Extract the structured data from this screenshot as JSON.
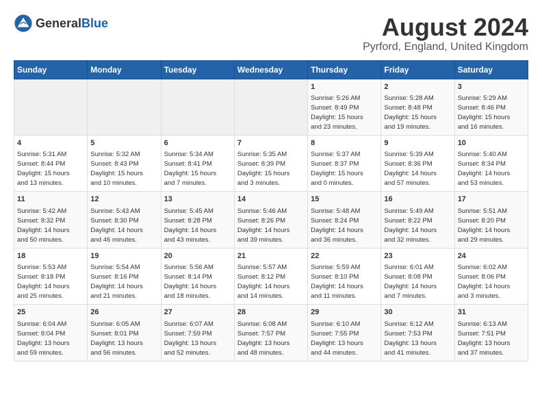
{
  "header": {
    "logo_general": "General",
    "logo_blue": "Blue",
    "title": "August 2024",
    "subtitle": "Pyrford, England, United Kingdom"
  },
  "weekdays": [
    "Sunday",
    "Monday",
    "Tuesday",
    "Wednesday",
    "Thursday",
    "Friday",
    "Saturday"
  ],
  "weeks": [
    [
      {
        "day": "",
        "info": ""
      },
      {
        "day": "",
        "info": ""
      },
      {
        "day": "",
        "info": ""
      },
      {
        "day": "",
        "info": ""
      },
      {
        "day": "1",
        "info": "Sunrise: 5:26 AM\nSunset: 8:49 PM\nDaylight: 15 hours\nand 23 minutes."
      },
      {
        "day": "2",
        "info": "Sunrise: 5:28 AM\nSunset: 8:48 PM\nDaylight: 15 hours\nand 19 minutes."
      },
      {
        "day": "3",
        "info": "Sunrise: 5:29 AM\nSunset: 8:46 PM\nDaylight: 15 hours\nand 16 minutes."
      }
    ],
    [
      {
        "day": "4",
        "info": "Sunrise: 5:31 AM\nSunset: 8:44 PM\nDaylight: 15 hours\nand 13 minutes."
      },
      {
        "day": "5",
        "info": "Sunrise: 5:32 AM\nSunset: 8:43 PM\nDaylight: 15 hours\nand 10 minutes."
      },
      {
        "day": "6",
        "info": "Sunrise: 5:34 AM\nSunset: 8:41 PM\nDaylight: 15 hours\nand 7 minutes."
      },
      {
        "day": "7",
        "info": "Sunrise: 5:35 AM\nSunset: 8:39 PM\nDaylight: 15 hours\nand 3 minutes."
      },
      {
        "day": "8",
        "info": "Sunrise: 5:37 AM\nSunset: 8:37 PM\nDaylight: 15 hours\nand 0 minutes."
      },
      {
        "day": "9",
        "info": "Sunrise: 5:39 AM\nSunset: 8:36 PM\nDaylight: 14 hours\nand 57 minutes."
      },
      {
        "day": "10",
        "info": "Sunrise: 5:40 AM\nSunset: 8:34 PM\nDaylight: 14 hours\nand 53 minutes."
      }
    ],
    [
      {
        "day": "11",
        "info": "Sunrise: 5:42 AM\nSunset: 8:32 PM\nDaylight: 14 hours\nand 50 minutes."
      },
      {
        "day": "12",
        "info": "Sunrise: 5:43 AM\nSunset: 8:30 PM\nDaylight: 14 hours\nand 46 minutes."
      },
      {
        "day": "13",
        "info": "Sunrise: 5:45 AM\nSunset: 8:28 PM\nDaylight: 14 hours\nand 43 minutes."
      },
      {
        "day": "14",
        "info": "Sunrise: 5:46 AM\nSunset: 8:26 PM\nDaylight: 14 hours\nand 39 minutes."
      },
      {
        "day": "15",
        "info": "Sunrise: 5:48 AM\nSunset: 8:24 PM\nDaylight: 14 hours\nand 36 minutes."
      },
      {
        "day": "16",
        "info": "Sunrise: 5:49 AM\nSunset: 8:22 PM\nDaylight: 14 hours\nand 32 minutes."
      },
      {
        "day": "17",
        "info": "Sunrise: 5:51 AM\nSunset: 8:20 PM\nDaylight: 14 hours\nand 29 minutes."
      }
    ],
    [
      {
        "day": "18",
        "info": "Sunrise: 5:53 AM\nSunset: 8:18 PM\nDaylight: 14 hours\nand 25 minutes."
      },
      {
        "day": "19",
        "info": "Sunrise: 5:54 AM\nSunset: 8:16 PM\nDaylight: 14 hours\nand 21 minutes."
      },
      {
        "day": "20",
        "info": "Sunrise: 5:56 AM\nSunset: 8:14 PM\nDaylight: 14 hours\nand 18 minutes."
      },
      {
        "day": "21",
        "info": "Sunrise: 5:57 AM\nSunset: 8:12 PM\nDaylight: 14 hours\nand 14 minutes."
      },
      {
        "day": "22",
        "info": "Sunrise: 5:59 AM\nSunset: 8:10 PM\nDaylight: 14 hours\nand 11 minutes."
      },
      {
        "day": "23",
        "info": "Sunrise: 6:01 AM\nSunset: 8:08 PM\nDaylight: 14 hours\nand 7 minutes."
      },
      {
        "day": "24",
        "info": "Sunrise: 6:02 AM\nSunset: 8:06 PM\nDaylight: 14 hours\nand 3 minutes."
      }
    ],
    [
      {
        "day": "25",
        "info": "Sunrise: 6:04 AM\nSunset: 8:04 PM\nDaylight: 13 hours\nand 59 minutes."
      },
      {
        "day": "26",
        "info": "Sunrise: 6:05 AM\nSunset: 8:01 PM\nDaylight: 13 hours\nand 56 minutes."
      },
      {
        "day": "27",
        "info": "Sunrise: 6:07 AM\nSunset: 7:59 PM\nDaylight: 13 hours\nand 52 minutes."
      },
      {
        "day": "28",
        "info": "Sunrise: 6:08 AM\nSunset: 7:57 PM\nDaylight: 13 hours\nand 48 minutes."
      },
      {
        "day": "29",
        "info": "Sunrise: 6:10 AM\nSunset: 7:55 PM\nDaylight: 13 hours\nand 44 minutes."
      },
      {
        "day": "30",
        "info": "Sunrise: 6:12 AM\nSunset: 7:53 PM\nDaylight: 13 hours\nand 41 minutes."
      },
      {
        "day": "31",
        "info": "Sunrise: 6:13 AM\nSunset: 7:51 PM\nDaylight: 13 hours\nand 37 minutes."
      }
    ]
  ]
}
